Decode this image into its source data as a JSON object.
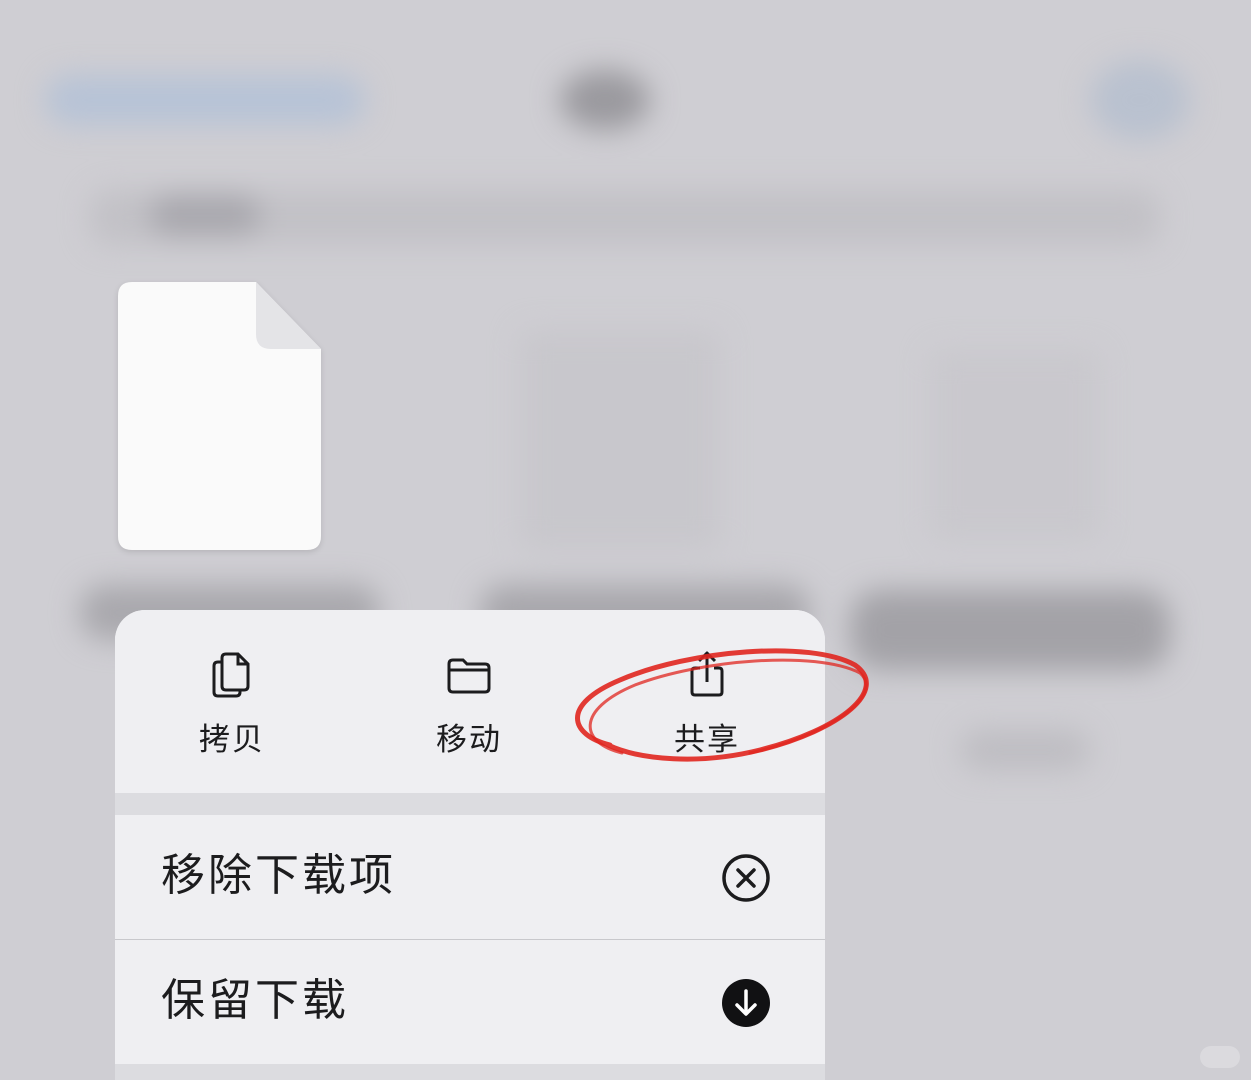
{
  "file": {
    "icon": "blank-document-icon"
  },
  "menu": {
    "quick_actions": [
      {
        "label": "拷贝",
        "icon": "copy-icon"
      },
      {
        "label": "移动",
        "icon": "folder-icon"
      },
      {
        "label": "共享",
        "icon": "share-icon"
      }
    ],
    "rows": [
      {
        "label": "移除下载项",
        "icon": "x-circle-icon"
      },
      {
        "label": "保留下载",
        "icon": "download-circle-filled-icon"
      }
    ]
  },
  "annotation": {
    "color": "#e0261f",
    "target": "共享"
  },
  "colors": {
    "menu_background": "#efeff2",
    "separator": "#dcdce0",
    "text": "#1c1c1e",
    "background": "#cfced3"
  }
}
